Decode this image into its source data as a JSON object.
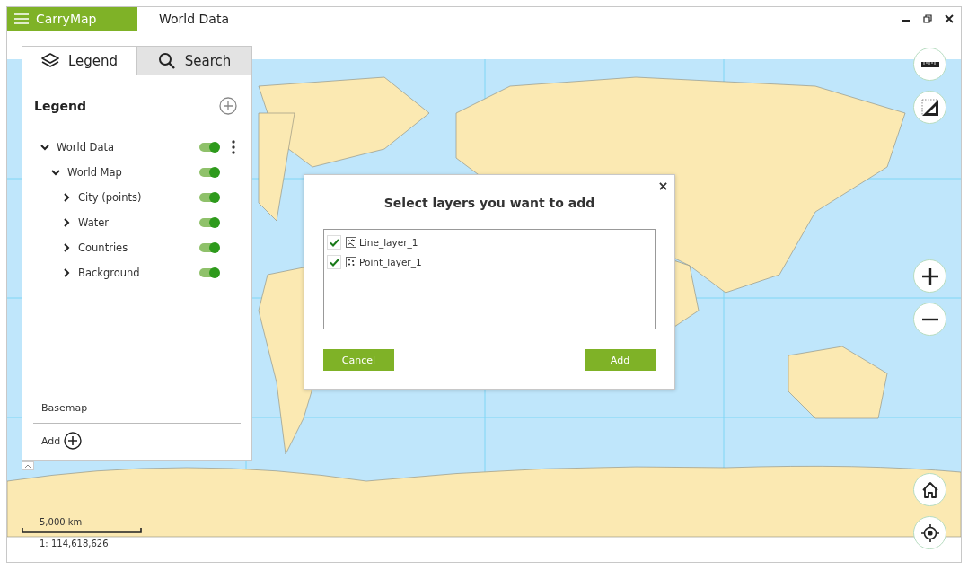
{
  "app": {
    "name": "CarryMap",
    "document_title": "World Data"
  },
  "panel": {
    "tabs": [
      {
        "label": "Legend",
        "kind": "layers",
        "selected": true
      },
      {
        "label": "Search",
        "kind": "search",
        "selected": false
      }
    ],
    "heading": "Legend",
    "layers": [
      {
        "name": "World Data",
        "expanded": true,
        "on": true,
        "children": [
          {
            "name": "World Map",
            "expanded": true,
            "on": true,
            "children": [
              {
                "name": "City (points)",
                "expanded": false,
                "on": true
              },
              {
                "name": "Water",
                "expanded": false,
                "on": true
              },
              {
                "name": "Countries",
                "expanded": false,
                "on": true
              },
              {
                "name": "Background",
                "expanded": false,
                "on": true
              }
            ]
          }
        ]
      }
    ],
    "basemap": "Basemap",
    "add": "Add"
  },
  "dialog": {
    "title": "Select layers you want to add",
    "layers": [
      {
        "name": "Line_layer_1",
        "kind": "line",
        "checked": true
      },
      {
        "name": "Point_layer_1",
        "kind": "point",
        "checked": true
      }
    ],
    "buttons": [
      {
        "label": "Cancel"
      },
      {
        "label": "Add"
      }
    ]
  },
  "scale": {
    "distance": "5,000 km",
    "ratio": "1: 114,618,626"
  }
}
